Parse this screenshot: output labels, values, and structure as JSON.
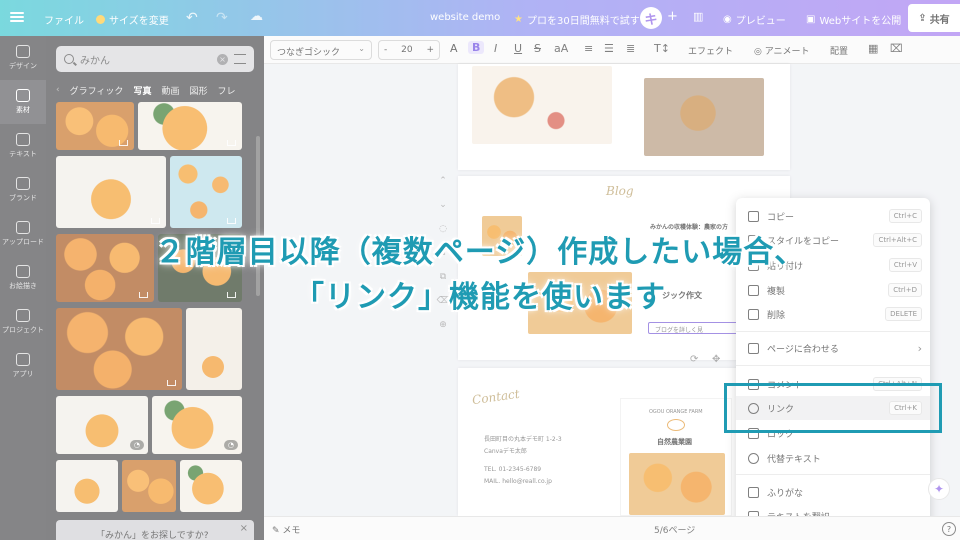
{
  "topbar": {
    "file": "ファイル",
    "resize": "サイズを変更",
    "project_name": "website demo",
    "pro_trial": "プロを30日間無料で試す",
    "avatar": "キ",
    "preview": "プレビュー",
    "publish": "Webサイトを公開",
    "share": "共有"
  },
  "rail": {
    "items": [
      {
        "label": "デザイン",
        "icon": "layout-icon"
      },
      {
        "label": "素材",
        "icon": "elements-icon"
      },
      {
        "label": "テキスト",
        "icon": "text-icon"
      },
      {
        "label": "ブランド",
        "icon": "brand-icon"
      },
      {
        "label": "アップロード",
        "icon": "upload-icon"
      },
      {
        "label": "お絵描き",
        "icon": "draw-icon"
      },
      {
        "label": "プロジェクト",
        "icon": "folder-icon"
      },
      {
        "label": "アプリ",
        "icon": "apps-icon"
      }
    ]
  },
  "panel": {
    "search_value": "みかん",
    "tabs": [
      "グラフィック",
      "写真",
      "動画",
      "図形",
      "フレ"
    ],
    "selected_tab": "写真",
    "suggest": "「みかん」をお探しですか?"
  },
  "toolbar": {
    "font": "つなぎゴシック",
    "size": "20",
    "effects": "エフェクト",
    "animate": "アニメート",
    "position": "配置"
  },
  "canvas": {
    "heading": "みかんの収穫体験：農家の方",
    "magic": "ジック作文",
    "button": "ブログを詳しく見",
    "address1": "長田町目の丸本デモ町 1-2-3",
    "address2": "Canvaデモ太郎",
    "tel": "TEL. 01-2345-6789",
    "mail": "MAIL. hello@reall.co.jp",
    "contact_script": "Contact",
    "blog_script": "Blog",
    "farm_name": "自然農業園",
    "farm_small": "OGOU ORANGE FARM"
  },
  "context_menu": {
    "items": [
      {
        "label": "コピー",
        "shortcut": "Ctrl+C",
        "icon": "copy-icon"
      },
      {
        "label": "スタイルをコピー",
        "shortcut": "Ctrl+Alt+C",
        "icon": "paint-roller-icon"
      },
      {
        "label": "貼り付け",
        "shortcut": "Ctrl+V",
        "icon": "paste-icon"
      },
      {
        "label": "複製",
        "shortcut": "Ctrl+D",
        "icon": "duplicate-icon"
      },
      {
        "label": "削除",
        "shortcut": "DELETE",
        "icon": "trash-icon"
      },
      {
        "label": "ページに合わせる",
        "shortcut": "",
        "icon": "fit-page-icon"
      },
      {
        "label": "コメント",
        "shortcut": "Ctrl+Alt+N",
        "icon": "comment-icon"
      },
      {
        "label": "リンク",
        "shortcut": "Ctrl+K",
        "icon": "link-icon"
      },
      {
        "label": "ロック",
        "shortcut": "",
        "icon": "lock-icon"
      },
      {
        "label": "代替テキスト",
        "shortcut": "",
        "icon": "alt-text-icon"
      },
      {
        "label": "ふりがな",
        "shortcut": "",
        "icon": "furigana-icon"
      },
      {
        "label": "テキストを翻訳",
        "shortcut": "",
        "icon": "translate-icon"
      }
    ]
  },
  "bottombar": {
    "notes": "メモ",
    "page_count": "5/6ページ",
    "help": "?"
  },
  "overlay": {
    "line1": "２階層目以降（複数ページ）作成したい場合、",
    "line2": "「リンク」機能を使います",
    "accent": "#1f9bb3"
  }
}
